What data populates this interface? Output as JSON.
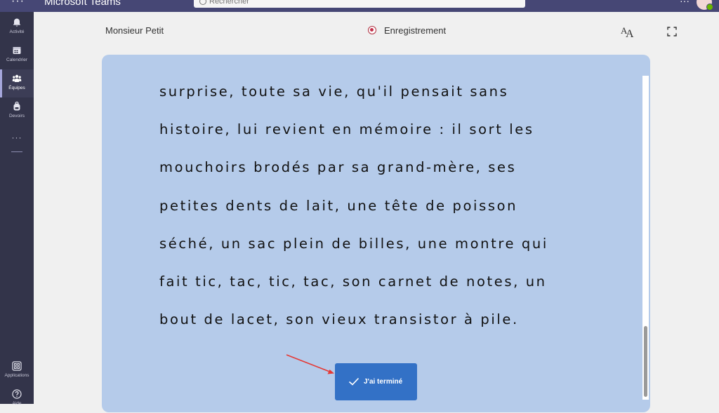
{
  "app": {
    "title": "Microsoft Teams",
    "menu_icon": "more-dots-icon"
  },
  "search": {
    "placeholder": "Rechercher"
  },
  "rail": {
    "items": [
      {
        "label": "Activité",
        "icon": "bell-icon"
      },
      {
        "label": "Calendrier",
        "icon": "calendar-icon"
      },
      {
        "label": "Équipes",
        "icon": "teams-icon",
        "active": true
      },
      {
        "label": "Devoirs",
        "icon": "backpack-icon"
      }
    ],
    "bottom": [
      {
        "label": "Applications",
        "icon": "apps-icon"
      },
      {
        "label": "Aide",
        "icon": "help-icon"
      }
    ]
  },
  "header": {
    "speaker_name": "Monsieur Petit",
    "recording_label": "Enregistrement",
    "recording_color": "#c4314b"
  },
  "reader": {
    "lines": [
      "surprise, toute sa vie, qu'il pensait sans",
      "histoire, lui revient en mémoire : il sort les",
      "mouchoirs brodés par sa grand-mère, ses",
      "petites dents de lait, une tête de poisson",
      "séché, un sac plein de billes, une montre qui",
      "fait tic, tac, tic, tac, son carnet de notes, un",
      "bout de lacet, son vieux transistor à pile."
    ],
    "background": "#b5cbea"
  },
  "done_button": {
    "label": "J'ai terminé",
    "color": "#3371c6"
  },
  "annotation": {
    "arrow_color": "#e53935"
  }
}
